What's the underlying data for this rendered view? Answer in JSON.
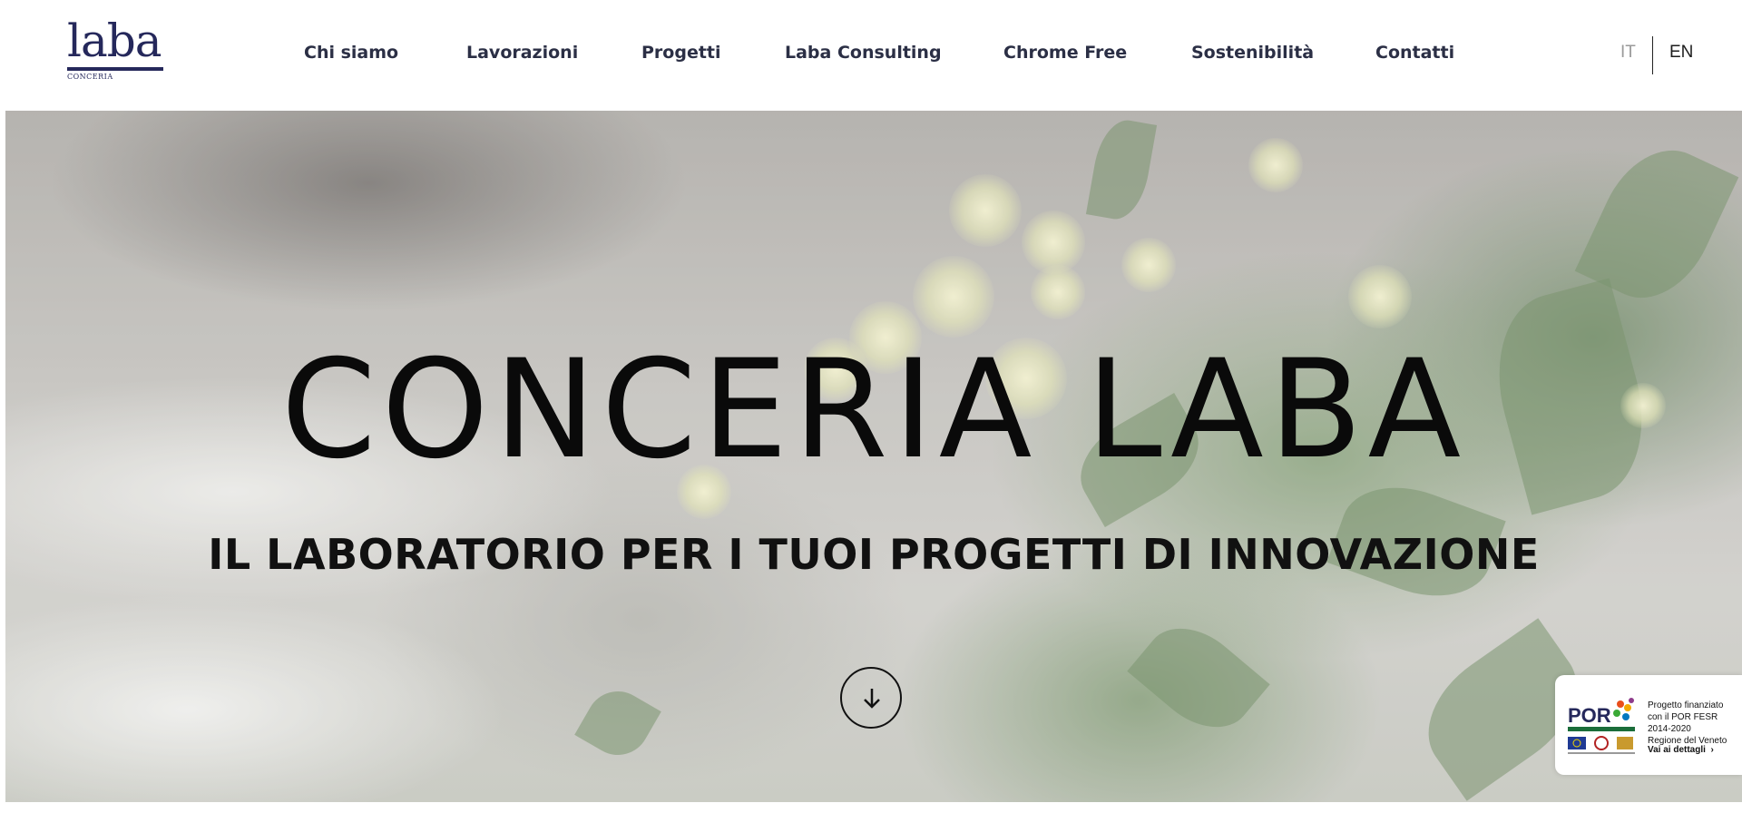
{
  "logo": {
    "word": "laba",
    "sub": "CONCERIA",
    "color": "#25285b"
  },
  "nav": {
    "items": [
      {
        "label": "Chi siamo"
      },
      {
        "label": "Lavorazioni"
      },
      {
        "label": "Progetti"
      },
      {
        "label": "Laba Consulting"
      },
      {
        "label": "Chrome Free"
      },
      {
        "label": "Sostenibilità"
      },
      {
        "label": "Contatti"
      }
    ]
  },
  "lang": {
    "it": "IT",
    "en": "EN",
    "active": "EN"
  },
  "hero": {
    "title": "CONCERIA LABA",
    "subtitle": "IL LABORATORIO PER I TUOI PROGETTI DI INNOVAZIONE",
    "scroll_icon": "arrow-down-icon"
  },
  "por_badge": {
    "logo_text": "POR",
    "line1": "Progetto finanziato",
    "line2": "con il POR FESR",
    "line3": "2014-2020",
    "line4": "Regione del Veneto",
    "link": "Vai ai dettagli"
  }
}
